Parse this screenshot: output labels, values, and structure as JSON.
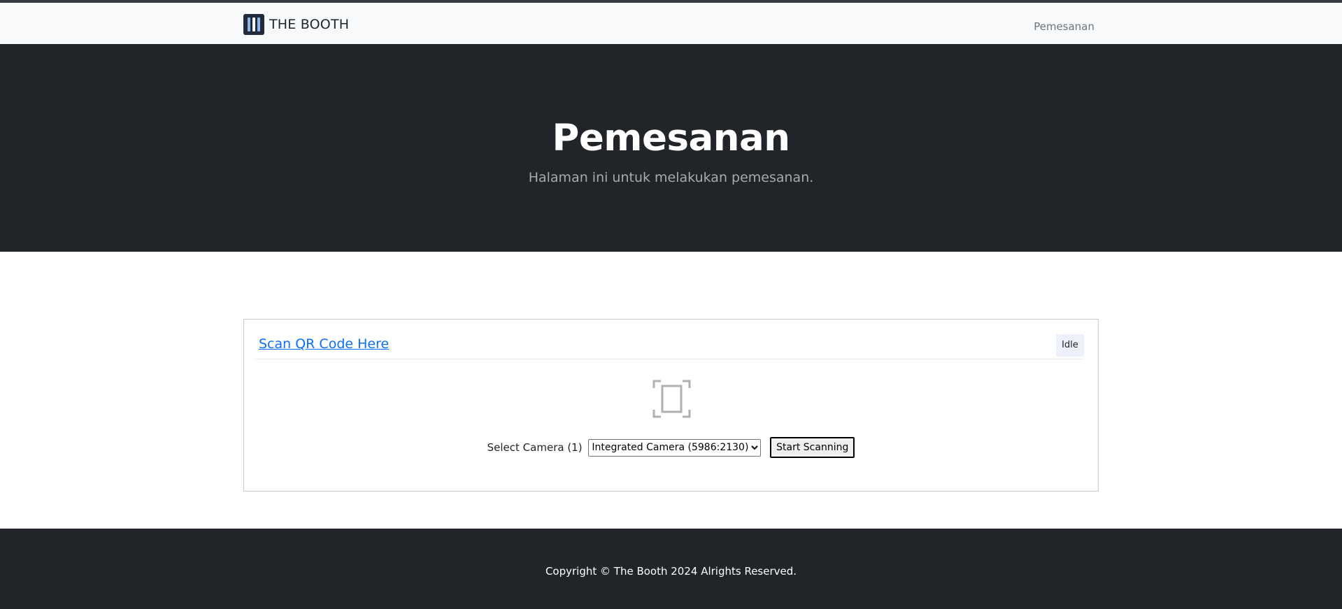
{
  "navbar": {
    "brand": "THE BOOTH",
    "brand_icon": "booth-logo-icon",
    "links": [
      "Pemesanan"
    ]
  },
  "hero": {
    "title": "Pemesanan",
    "subtitle": "Halaman ini untuk melakukan pemesanan."
  },
  "scanner": {
    "header_link": "Scan QR Code Here",
    "status": "Idle",
    "icon": "qr-scan-frame-icon",
    "camera_label": "Select Camera (1)",
    "camera_selected": "Integrated Camera (5986:2130)",
    "camera_options": [
      "Integrated Camera (5986:2130)"
    ],
    "start_button": "Start Scanning"
  },
  "footer": {
    "copyright": "Copyright © The Booth 2024 Alrights Reserved."
  },
  "colors": {
    "navbar_bg": "#f8f9fa",
    "dark_bg": "#212529",
    "link": "#0d6efd",
    "status_bg": "#eef0fb"
  }
}
